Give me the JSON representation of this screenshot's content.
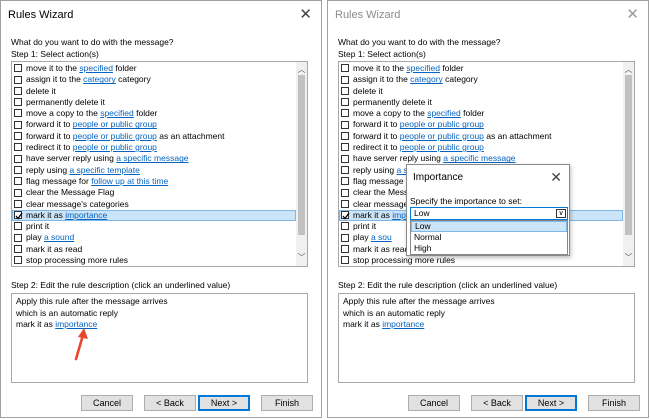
{
  "left_window": {
    "title": "Rules Wizard",
    "prompt": "What do you want to do with the message?",
    "step1": "Step 1: Select action(s)",
    "actions": [
      {
        "pre": "move it to the ",
        "link": "specified",
        "post": " folder",
        "checked": false
      },
      {
        "pre": "assign it to the ",
        "link": "category",
        "post": " category",
        "checked": false
      },
      {
        "pre": "delete it",
        "link": "",
        "post": "",
        "checked": false
      },
      {
        "pre": "permanently delete it",
        "link": "",
        "post": "",
        "checked": false
      },
      {
        "pre": "move a copy to the ",
        "link": "specified",
        "post": " folder",
        "checked": false
      },
      {
        "pre": "forward it to ",
        "link": "people or public group",
        "post": "",
        "checked": false
      },
      {
        "pre": "forward it to ",
        "link": "people or public group",
        "post": " as an attachment",
        "checked": false
      },
      {
        "pre": "redirect it to ",
        "link": "people or public group",
        "post": "",
        "checked": false
      },
      {
        "pre": "have server reply using ",
        "link": "a specific message",
        "post": "",
        "checked": false
      },
      {
        "pre": "reply using ",
        "link": "a specific template",
        "post": "",
        "checked": false
      },
      {
        "pre": "flag message for ",
        "link": "follow up at this time",
        "post": "",
        "checked": false
      },
      {
        "pre": "clear the Message Flag",
        "link": "",
        "post": "",
        "checked": false
      },
      {
        "pre": "clear message's categories",
        "link": "",
        "post": "",
        "checked": false
      },
      {
        "pre": "mark it as ",
        "link": "importance",
        "post": "",
        "checked": true
      },
      {
        "pre": "print it",
        "link": "",
        "post": "",
        "checked": false
      },
      {
        "pre": "play ",
        "link": "a sound",
        "post": "",
        "checked": false
      },
      {
        "pre": "mark it as read",
        "link": "",
        "post": "",
        "checked": false
      },
      {
        "pre": "stop processing more rules",
        "link": "",
        "post": "",
        "checked": false
      }
    ],
    "step2": "Step 2: Edit the rule description (click an underlined value)",
    "desc_line1": "Apply this rule after the message arrives",
    "desc_line2": "which is an automatic reply",
    "desc_line3_pre": "mark it as ",
    "desc_line3_link": "importance",
    "buttons": {
      "cancel": "Cancel",
      "back": "< Back",
      "next": "Next >",
      "finish": "Finish"
    }
  },
  "right_window": {
    "title": "Rules Wizard",
    "prompt": "What do you want to do with the message?",
    "step1": "Step 1: Select action(s)",
    "actions": [
      {
        "pre": "move it to the ",
        "link": "specified",
        "post": " folder",
        "checked": false
      },
      {
        "pre": "assign it to the ",
        "link": "category",
        "post": " category",
        "checked": false
      },
      {
        "pre": "delete it",
        "link": "",
        "post": "",
        "checked": false
      },
      {
        "pre": "permanently delete it",
        "link": "",
        "post": "",
        "checked": false
      },
      {
        "pre": "move a copy to the ",
        "link": "specified",
        "post": " folder",
        "checked": false
      },
      {
        "pre": "forward it to ",
        "link": "people or public group",
        "post": "",
        "checked": false
      },
      {
        "pre": "forward it to ",
        "link": "people or public group",
        "post": " as an attachment",
        "checked": false
      },
      {
        "pre": "redirect it to ",
        "link": "people or public group",
        "post": "",
        "checked": false
      },
      {
        "pre": "have server reply using ",
        "link": "a specific message",
        "post": "",
        "checked": false
      },
      {
        "pre": "reply using ",
        "link": "a s",
        "post": "",
        "checked": false
      },
      {
        "pre": "flag message f",
        "link": "",
        "post": "",
        "checked": false
      },
      {
        "pre": "clear the Messa",
        "link": "",
        "post": "",
        "checked": false
      },
      {
        "pre": "clear message'",
        "link": "",
        "post": "",
        "checked": false
      },
      {
        "pre": "mark it as ",
        "link": "imp",
        "post": "",
        "checked": true
      },
      {
        "pre": "print it",
        "link": "",
        "post": "",
        "checked": false
      },
      {
        "pre": "play ",
        "link": "a sou",
        "post": "",
        "checked": false
      },
      {
        "pre": "mark it as read",
        "link": "",
        "post": "",
        "checked": false
      },
      {
        "pre": "stop processing more rules",
        "link": "",
        "post": "",
        "checked": false
      }
    ],
    "step2": "Step 2: Edit the rule description (click an underlined value)",
    "desc_line1": "Apply this rule after the message arrives",
    "desc_line2": "which is an automatic reply",
    "desc_line3_pre": "mark it as ",
    "desc_line3_link": "importance",
    "buttons": {
      "cancel": "Cancel",
      "back": "< Back",
      "next": "Next >",
      "finish": "Finish"
    }
  },
  "importance_dialog": {
    "title": "Importance",
    "label": "Specify the importance to set:",
    "selected": "Low",
    "options": [
      "Low",
      "Normal",
      "High"
    ]
  },
  "icons": {
    "close": "close-icon",
    "scroll_up": "chevron-up-icon",
    "scroll_down": "chevron-down-icon",
    "dropdown": "chevron-down-icon",
    "annotation": "red-arrow-icon",
    "checkmark": "checkmark-icon"
  },
  "colors": {
    "link": "#0563c1",
    "selection": "#cce4f7",
    "accent": "#0078d7",
    "annotation_arrow": "#e8462d"
  }
}
